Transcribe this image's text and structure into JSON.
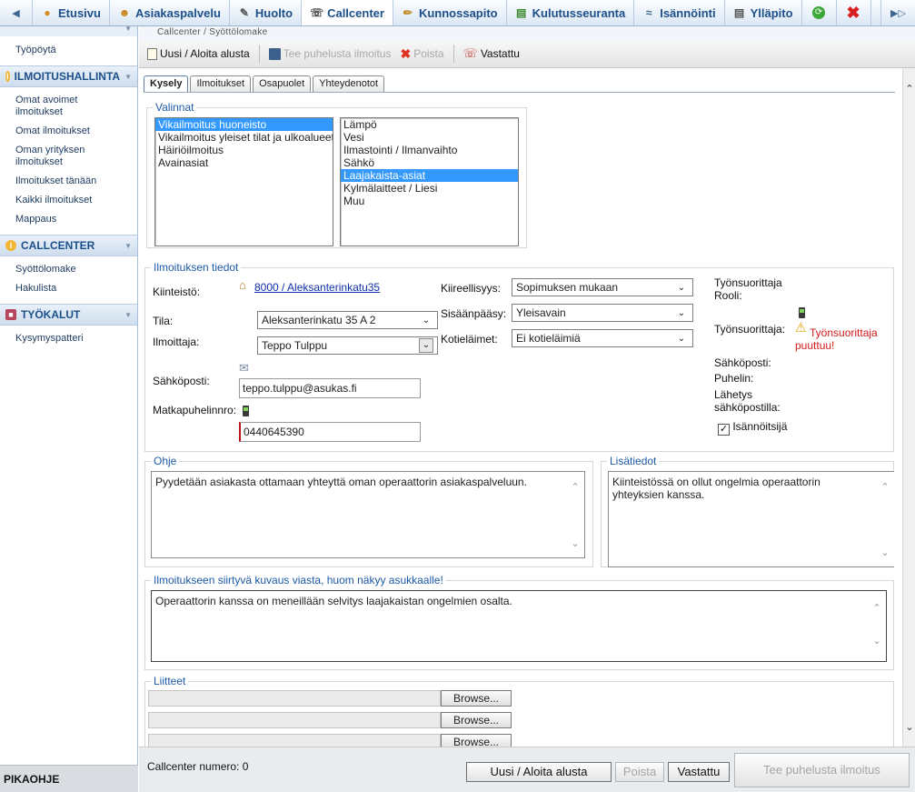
{
  "nav": {
    "tabs": [
      {
        "label": "Etusivu",
        "icon": "home-icon"
      },
      {
        "label": "Asiakaspalvelu",
        "icon": "people-icon"
      },
      {
        "label": "Huolto",
        "icon": "wrench-note-icon"
      },
      {
        "label": "Callcenter",
        "icon": "phone-icon"
      },
      {
        "label": "Kunnossapito",
        "icon": "pencil-icon"
      },
      {
        "label": "Kulutusseuranta",
        "icon": "chart-icon"
      },
      {
        "label": "Isännöinti",
        "icon": "handshake-icon"
      },
      {
        "label": "Ylläpito",
        "icon": "document-icon"
      }
    ],
    "active_tab": "Callcenter"
  },
  "sidebar": {
    "top_link": "Työpöytä",
    "groups": [
      {
        "title": "ILMOITUSHALLINTA",
        "items": [
          "Omat avoimet ilmoitukset",
          "Omat ilmoitukset",
          "Oman yrityksen ilmoitukset",
          "Ilmoitukset tänään",
          "Kaikki ilmoitukset",
          "Mappaus"
        ]
      },
      {
        "title": "CALLCENTER",
        "items": [
          "Syöttölomake",
          "Hakulista"
        ]
      },
      {
        "title": "TYÖKALUT",
        "items": [
          "Kysymyspatteri"
        ]
      }
    ],
    "bottom": "PIKAOHJE"
  },
  "breadcrumb": "Callcenter / Syöttölomake",
  "toolbar": {
    "new": "Uusi / Aloita alusta",
    "save": "Tee puhelusta ilmoitus",
    "delete": "Poista",
    "answered": "Vastattu"
  },
  "form_tabs": [
    "Kysely",
    "Ilmoitukset",
    "Osapuolet",
    "Yhteydenotot"
  ],
  "valinnat": {
    "legend": "Valinnat",
    "list1": [
      "Vikailmoitus huoneisto",
      "Vikailmoitus yleiset tilat ja ulkoalueet",
      "Häiriöilmoitus",
      "Avainasiat"
    ],
    "list1_selected": 0,
    "list2": [
      "Lämpö",
      "Vesi",
      "Ilmastointi / Ilmanvaihto",
      "Sähkö",
      "Laajakaista-asiat",
      "Kylmälaitteet / Liesi",
      "Muu"
    ],
    "list2_selected": 4
  },
  "details": {
    "legend": "Ilmoituksen tiedot",
    "kiinteisto_label": "Kiinteistö:",
    "kiinteisto_value": "8000 / Aleksanterinkatu35",
    "tila_label": "Tila:",
    "tila_value": "Aleksanterinkatu 35 A 2",
    "ilmoittaja_label": "Ilmoittaja:",
    "ilmoittaja_value": "Teppo Tulppu",
    "email_label": "Sähköposti:",
    "email_value": "teppo.tulppu@asukas.fi",
    "mobile_label": "Matkapuhelinnro:",
    "mobile_value": "0440645390",
    "kiireellisyys_label": "Kiireellisyys:",
    "kiireellisyys_value": "Sopimuksen mukaan",
    "sisaanpaasy_label": "Sisäänpääsy:",
    "sisaanpaasy_value": "Yleisavain",
    "kotielaimet_label": "Kotieläimet:",
    "kotielaimet_value": "Ei kotieläimiä",
    "rooli_label": "Työnsuorittaja Rooli:",
    "tyonsuorittaja_label": "Työnsuorittaja:",
    "tyonsuorittaja_warning": "Työnsuorittaja puuttuu!",
    "r_email_label": "Sähköposti:",
    "puhelin_label": "Puhelin:",
    "lahetys_label": "Lähetys sähköpostilla:",
    "isannoitsija_label": "Isännöitsijä",
    "isannoitsija_checked": true
  },
  "ohje": {
    "legend": "Ohje",
    "text": "Pyydetään asiakasta ottamaan yhteyttä oman operaattorin asiakaspalveluun."
  },
  "lisatiedot": {
    "legend": "Lisätiedot",
    "text": "Kiinteistössä on ollut ongelmia operaattorin yhteyksien kanssa."
  },
  "kuvaus": {
    "legend": "Ilmoitukseen siirtyvä kuvaus viasta, huom näkyy asukkaalle!",
    "text": "Operaattorin kanssa on meneillään selvitys laajakaistan ongelmien osalta."
  },
  "liitteet": {
    "legend": "Liitteet",
    "browse": "Browse..."
  },
  "footer": {
    "number_label": "Callcenter numero: 0",
    "new": "Uusi / Aloita alusta",
    "delete": "Poista",
    "answered": "Vastattu",
    "save": "Tee puhelusta ilmoitus"
  }
}
